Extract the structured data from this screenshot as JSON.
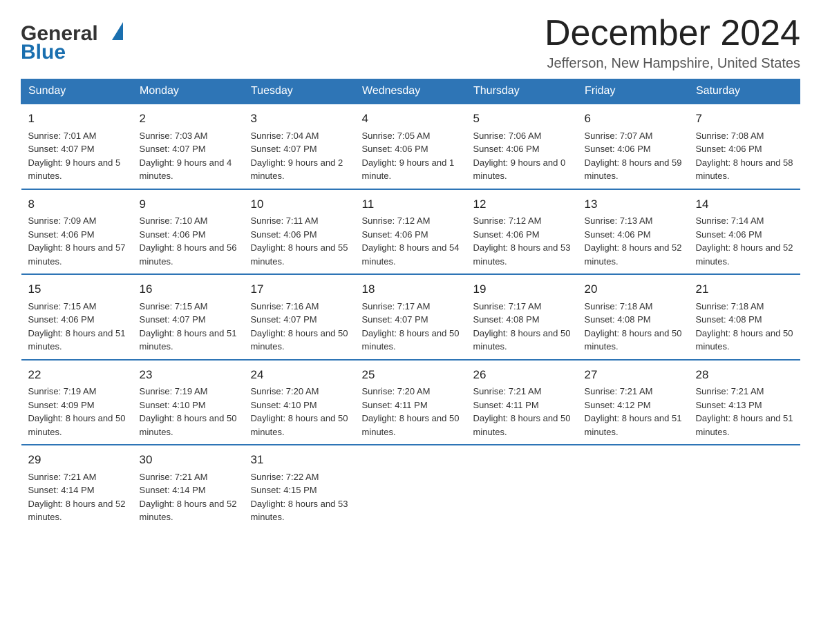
{
  "logo": {
    "general": "General",
    "blue": "Blue",
    "triangle_color": "#1a6faf"
  },
  "header": {
    "month": "December 2024",
    "location": "Jefferson, New Hampshire, United States"
  },
  "weekdays": [
    "Sunday",
    "Monday",
    "Tuesday",
    "Wednesday",
    "Thursday",
    "Friday",
    "Saturday"
  ],
  "weeks": [
    [
      {
        "day": "1",
        "sunrise": "7:01 AM",
        "sunset": "4:07 PM",
        "daylight": "9 hours and 5 minutes."
      },
      {
        "day": "2",
        "sunrise": "7:03 AM",
        "sunset": "4:07 PM",
        "daylight": "9 hours and 4 minutes."
      },
      {
        "day": "3",
        "sunrise": "7:04 AM",
        "sunset": "4:07 PM",
        "daylight": "9 hours and 2 minutes."
      },
      {
        "day": "4",
        "sunrise": "7:05 AM",
        "sunset": "4:06 PM",
        "daylight": "9 hours and 1 minute."
      },
      {
        "day": "5",
        "sunrise": "7:06 AM",
        "sunset": "4:06 PM",
        "daylight": "9 hours and 0 minutes."
      },
      {
        "day": "6",
        "sunrise": "7:07 AM",
        "sunset": "4:06 PM",
        "daylight": "8 hours and 59 minutes."
      },
      {
        "day": "7",
        "sunrise": "7:08 AM",
        "sunset": "4:06 PM",
        "daylight": "8 hours and 58 minutes."
      }
    ],
    [
      {
        "day": "8",
        "sunrise": "7:09 AM",
        "sunset": "4:06 PM",
        "daylight": "8 hours and 57 minutes."
      },
      {
        "day": "9",
        "sunrise": "7:10 AM",
        "sunset": "4:06 PM",
        "daylight": "8 hours and 56 minutes."
      },
      {
        "day": "10",
        "sunrise": "7:11 AM",
        "sunset": "4:06 PM",
        "daylight": "8 hours and 55 minutes."
      },
      {
        "day": "11",
        "sunrise": "7:12 AM",
        "sunset": "4:06 PM",
        "daylight": "8 hours and 54 minutes."
      },
      {
        "day": "12",
        "sunrise": "7:12 AM",
        "sunset": "4:06 PM",
        "daylight": "8 hours and 53 minutes."
      },
      {
        "day": "13",
        "sunrise": "7:13 AM",
        "sunset": "4:06 PM",
        "daylight": "8 hours and 52 minutes."
      },
      {
        "day": "14",
        "sunrise": "7:14 AM",
        "sunset": "4:06 PM",
        "daylight": "8 hours and 52 minutes."
      }
    ],
    [
      {
        "day": "15",
        "sunrise": "7:15 AM",
        "sunset": "4:06 PM",
        "daylight": "8 hours and 51 minutes."
      },
      {
        "day": "16",
        "sunrise": "7:15 AM",
        "sunset": "4:07 PM",
        "daylight": "8 hours and 51 minutes."
      },
      {
        "day": "17",
        "sunrise": "7:16 AM",
        "sunset": "4:07 PM",
        "daylight": "8 hours and 50 minutes."
      },
      {
        "day": "18",
        "sunrise": "7:17 AM",
        "sunset": "4:07 PM",
        "daylight": "8 hours and 50 minutes."
      },
      {
        "day": "19",
        "sunrise": "7:17 AM",
        "sunset": "4:08 PM",
        "daylight": "8 hours and 50 minutes."
      },
      {
        "day": "20",
        "sunrise": "7:18 AM",
        "sunset": "4:08 PM",
        "daylight": "8 hours and 50 minutes."
      },
      {
        "day": "21",
        "sunrise": "7:18 AM",
        "sunset": "4:08 PM",
        "daylight": "8 hours and 50 minutes."
      }
    ],
    [
      {
        "day": "22",
        "sunrise": "7:19 AM",
        "sunset": "4:09 PM",
        "daylight": "8 hours and 50 minutes."
      },
      {
        "day": "23",
        "sunrise": "7:19 AM",
        "sunset": "4:10 PM",
        "daylight": "8 hours and 50 minutes."
      },
      {
        "day": "24",
        "sunrise": "7:20 AM",
        "sunset": "4:10 PM",
        "daylight": "8 hours and 50 minutes."
      },
      {
        "day": "25",
        "sunrise": "7:20 AM",
        "sunset": "4:11 PM",
        "daylight": "8 hours and 50 minutes."
      },
      {
        "day": "26",
        "sunrise": "7:21 AM",
        "sunset": "4:11 PM",
        "daylight": "8 hours and 50 minutes."
      },
      {
        "day": "27",
        "sunrise": "7:21 AM",
        "sunset": "4:12 PM",
        "daylight": "8 hours and 51 minutes."
      },
      {
        "day": "28",
        "sunrise": "7:21 AM",
        "sunset": "4:13 PM",
        "daylight": "8 hours and 51 minutes."
      }
    ],
    [
      {
        "day": "29",
        "sunrise": "7:21 AM",
        "sunset": "4:14 PM",
        "daylight": "8 hours and 52 minutes."
      },
      {
        "day": "30",
        "sunrise": "7:21 AM",
        "sunset": "4:14 PM",
        "daylight": "8 hours and 52 minutes."
      },
      {
        "day": "31",
        "sunrise": "7:22 AM",
        "sunset": "4:15 PM",
        "daylight": "8 hours and 53 minutes."
      },
      null,
      null,
      null,
      null
    ]
  ]
}
